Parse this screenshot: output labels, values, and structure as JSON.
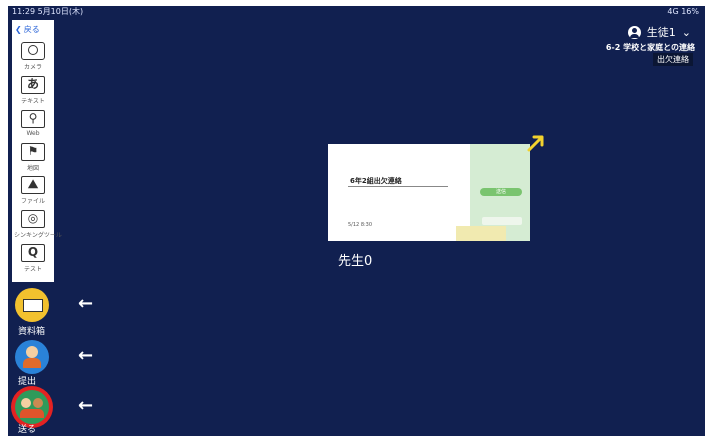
{
  "status": {
    "time": "11:29  5月10日(木)",
    "right": "4G 16%"
  },
  "user": {
    "name": "生徒1"
  },
  "class": {
    "title": "6-2 学校と家庭との連絡",
    "subtitle": "出欠連絡"
  },
  "toolbar": {
    "back_label": "戻る",
    "tools": [
      {
        "label": "カメラ",
        "icon": "camera-icon"
      },
      {
        "label": "テキスト",
        "icon": "text-icon"
      },
      {
        "label": "Web",
        "icon": "web-icon"
      },
      {
        "label": "地図",
        "icon": "map-icon"
      },
      {
        "label": "ファイル",
        "icon": "file-icon"
      },
      {
        "label": "シンキングツール",
        "icon": "thinking-tool-icon"
      },
      {
        "label": "テスト",
        "icon": "test-icon"
      }
    ]
  },
  "actions": {
    "box": {
      "label": "資料箱"
    },
    "submit": {
      "label": "提出"
    },
    "send": {
      "label": "送る"
    }
  },
  "card": {
    "title": "6年2組出欠連絡",
    "button": "送信",
    "meta": "5/12 8:30",
    "owner": "先生0"
  },
  "colors": {
    "background": "#112050",
    "accent_yellow": "#f2d22e",
    "send_highlight": "#e32222"
  }
}
